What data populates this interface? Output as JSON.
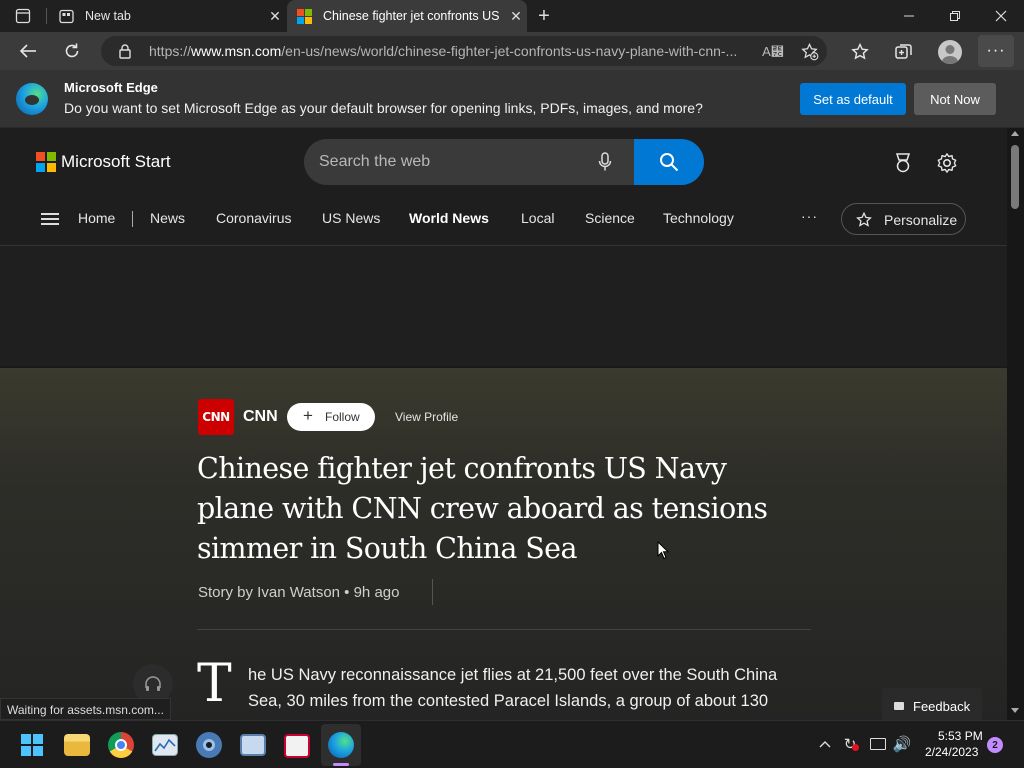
{
  "browser": {
    "tabs": [
      {
        "label": "New tab"
      },
      {
        "label": "Chinese fighter jet confronts US"
      }
    ],
    "url_prefix": "https://",
    "url_domain": "www.msn.com",
    "url_path": "/en-us/news/world/chinese-fighter-jet-confronts-us-navy-plane-with-cnn-..."
  },
  "infobar": {
    "title": "Microsoft Edge",
    "message": "Do you want to set Microsoft Edge as your default browser for opening links, PDFs, images, and more?",
    "primary_label": "Set as default",
    "secondary_label": "Not Now"
  },
  "header": {
    "logo_text": "Microsoft Start",
    "search_placeholder": "Search the web"
  },
  "nav": {
    "items": [
      {
        "label": "Home"
      },
      {
        "label": "News"
      },
      {
        "label": "Coronavirus"
      },
      {
        "label": "US News"
      },
      {
        "label": "World News"
      },
      {
        "label": "Local"
      },
      {
        "label": "Science"
      },
      {
        "label": "Technology"
      }
    ],
    "more_label": "···",
    "personalize_label": "Personalize"
  },
  "article": {
    "publisher_logo": "CNN",
    "publisher": "CNN",
    "follow_label": "Follow",
    "view_profile_label": "View Profile",
    "headline": "Chinese fighter jet confronts US Navy plane with CNN crew aboard as tensions simmer in South China Sea",
    "byline": "Story by Ivan Watson • 9h ago",
    "dropcap": "T",
    "body_line1": "he US Navy reconnaissance jet flies at 21,500 feet over the South China",
    "body_line2": "Sea, 30 miles from the contested Paracel Islands, a group of about 130"
  },
  "feedback_label": "Feedback",
  "status_text": "Waiting for assets.msn.com...",
  "clock": {
    "time": "5:53 PM",
    "date": "2/24/2023",
    "notifications": "2"
  },
  "colors": {
    "accent": "#0078d4",
    "cnn_red": "#cc0000",
    "edge_icon": "#1ba1e2"
  }
}
